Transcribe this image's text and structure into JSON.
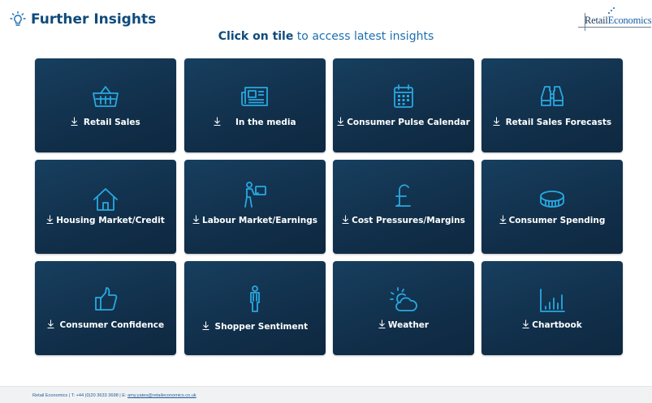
{
  "header": {
    "title": "Further Insights",
    "icon": "lightbulb-icon"
  },
  "logo": {
    "part1": "Retail",
    "part2": "Economics"
  },
  "subtitle": {
    "strong": "Click on tile",
    "rest": " to access latest insights"
  },
  "colors": {
    "tile_bg": "#143552",
    "icon": "#29a8e0",
    "title": "#0f4a7c",
    "subtitle": "#1d6fb0"
  },
  "tiles": [
    {
      "label": "Retail Sales",
      "icon": "basket-icon"
    },
    {
      "label": "In the media",
      "icon": "newspaper-icon"
    },
    {
      "label": "Consumer Pulse Calendar",
      "icon": "calendar-icon"
    },
    {
      "label": "Retail Sales Forecasts",
      "icon": "binoculars-icon"
    },
    {
      "label": "Housing Market/Credit",
      "icon": "house-icon"
    },
    {
      "label": "Labour Market/Earnings",
      "icon": "worker-icon"
    },
    {
      "label": "Cost Pressures/Margins",
      "icon": "pound-icon"
    },
    {
      "label": "Consumer Spending",
      "icon": "coin-icon"
    },
    {
      "label": "Consumer Confidence",
      "icon": "thumbs-up-icon"
    },
    {
      "label": "Shopper Sentiment",
      "icon": "person-icon"
    },
    {
      "label": "Weather",
      "icon": "weather-icon"
    },
    {
      "label": "Chartbook",
      "icon": "bar-chart-icon"
    }
  ],
  "footer": {
    "text": "Retail Economics | T: +44 (0)20 3633 3698 | E: ",
    "email": "amy.yates@retaileconomics.co.uk"
  }
}
